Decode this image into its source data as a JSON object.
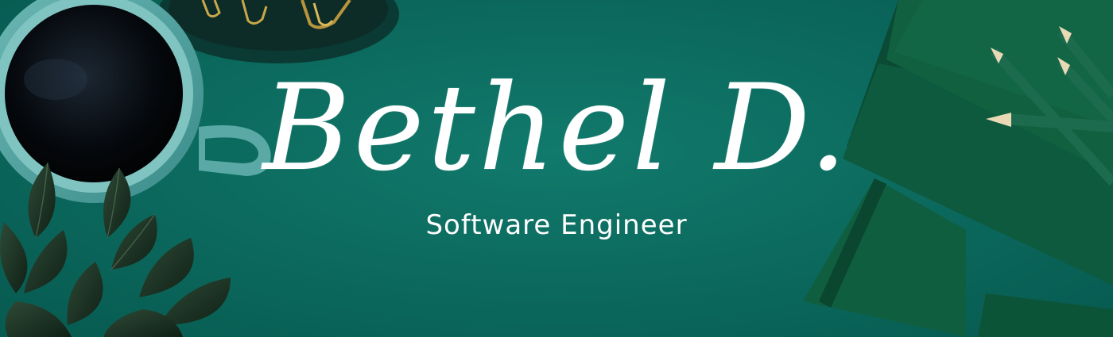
{
  "banner": {
    "name": "Bethel D.",
    "title": "Software Engineer"
  },
  "colors": {
    "background": "#0c6b5f",
    "text": "#ffffff",
    "notebook": "#0f5a3e",
    "mug": "#4fa3a1",
    "clip_gold": "#c9a84a"
  },
  "props": [
    "coffee-mug",
    "paper-clip-dish",
    "potted-plant",
    "stacked-notebooks",
    "pencils"
  ]
}
